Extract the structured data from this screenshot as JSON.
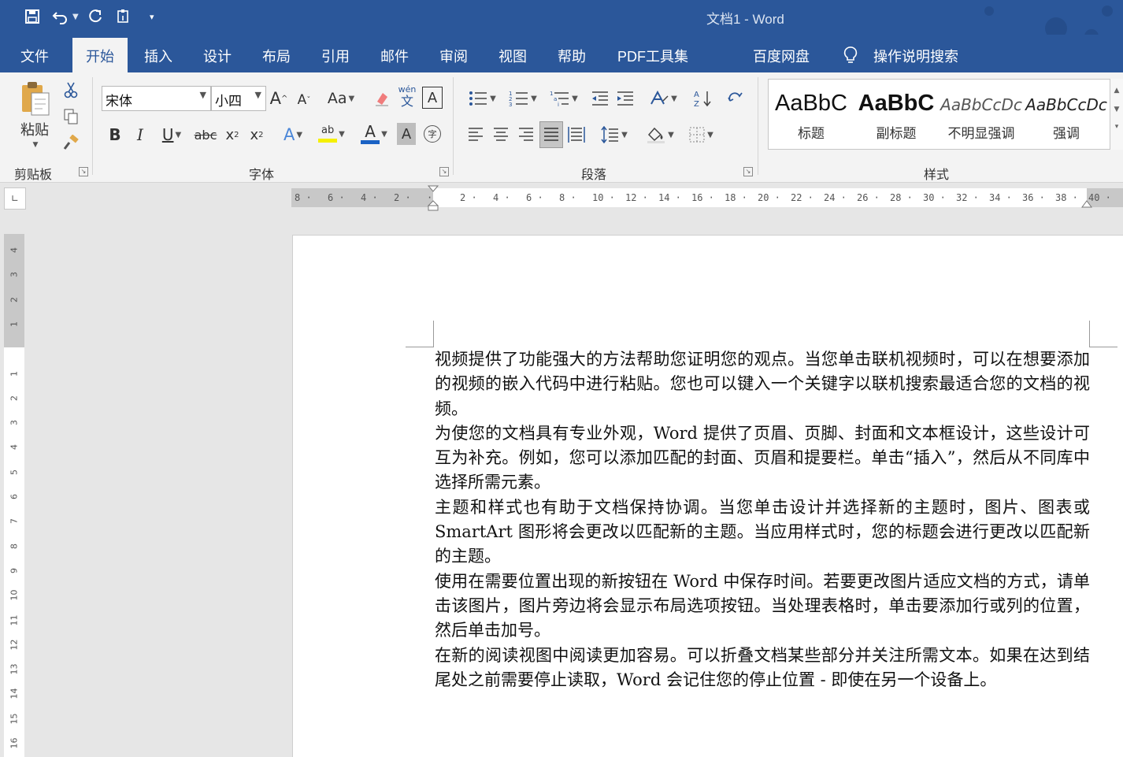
{
  "window": {
    "title": "文档1  -  Word"
  },
  "tabs": [
    "文件",
    "开始",
    "插入",
    "设计",
    "布局",
    "引用",
    "邮件",
    "审阅",
    "视图",
    "帮助",
    "PDF工具集",
    "百度网盘",
    "操作说明搜索"
  ],
  "active_tab": "开始",
  "accent_color": "#2b579a",
  "ribbon": {
    "clipboard": {
      "paste_label": "粘贴",
      "group_label": "剪贴板"
    },
    "font": {
      "font_name": "宋体",
      "font_size": "小四",
      "group_label": "字体",
      "change_case": "Aa",
      "phonetic": "wén",
      "phonetic_char": "文",
      "char_border": "A",
      "highlight_text": "ab",
      "font_color_text": "A",
      "shading_text": "A",
      "enclose_text": "字"
    },
    "paragraph": {
      "group_label": "段落"
    },
    "styles": {
      "group_label": "样式",
      "items": [
        {
          "sample": "AaBbC",
          "name": "标题"
        },
        {
          "sample": "AaBbC",
          "name": "副标题"
        },
        {
          "sample": "AaBbCcDc",
          "name": "不明显强调"
        },
        {
          "sample": "AaBbCcDc",
          "name": "强调"
        }
      ]
    }
  },
  "hruler_labels": [
    "8",
    "6",
    "4",
    "2",
    "",
    "2",
    "4",
    "6",
    "8",
    "10",
    "12",
    "14",
    "16",
    "18",
    "20",
    "22",
    "24",
    "26",
    "28",
    "30",
    "32",
    "34",
    "36",
    "38",
    "40"
  ],
  "vruler_labels": [
    "4",
    "3",
    "2",
    "1",
    "",
    "1",
    "2",
    "3",
    "4",
    "5",
    "6",
    "7",
    "8",
    "9",
    "10",
    "11",
    "12",
    "13",
    "14",
    "15",
    "16"
  ],
  "document": {
    "paragraphs": [
      "视频提供了功能强大的方法帮助您证明您的观点。当您单击联机视频时，可以在想要添加的视频的嵌入代码中进行粘贴。您也可以键入一个关键字以联机搜索最适合您的文档的视频。",
      "为使您的文档具有专业外观，Word 提供了页眉、页脚、封面和文本框设计，这些设计可互为补充。例如，您可以添加匹配的封面、页眉和提要栏。单击“插入”，然后从不同库中选择所需元素。",
      "主题和样式也有助于文档保持协调。当您单击设计并选择新的主题时，图片、图表或 SmartArt 图形将会更改以匹配新的主题。当应用样式时，您的标题会进行更改以匹配新的主题。",
      "使用在需要位置出现的新按钮在 Word 中保存时间。若要更改图片适应文档的方式，请单击该图片，图片旁边将会显示布局选项按钮。当处理表格时，单击要添加行或列的位置，然后单击加号。",
      "在新的阅读视图中阅读更加容易。可以折叠文档某些部分并关注所需文本。如果在达到结尾处之前需要停止读取，Word 会记住您的停止位置 - 即使在另一个设备上。"
    ]
  }
}
